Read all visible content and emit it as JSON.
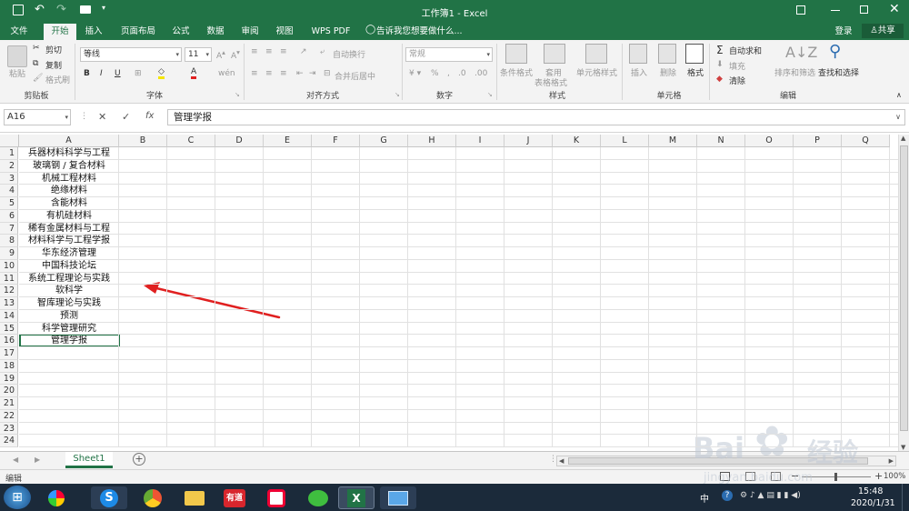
{
  "window": {
    "title": "工作簿1 - Excel"
  },
  "tabs": [
    "文件",
    "开始",
    "插入",
    "页面布局",
    "公式",
    "数据",
    "审阅",
    "视图",
    "WPS PDF"
  ],
  "tell_me": "告诉我您想要做什么...",
  "account": {
    "login": "登录",
    "share": "共享"
  },
  "ribbon": {
    "clipboard": {
      "label": "剪贴板",
      "paste": "粘贴",
      "cut": "剪切",
      "copy": "复制",
      "format_painter": "格式刷"
    },
    "font": {
      "label": "字体",
      "name": "等线",
      "size": "11"
    },
    "alignment": {
      "label": "对齐方式",
      "wrap": "自动换行",
      "merge": "合并后居中"
    },
    "number": {
      "label": "数字",
      "format": "常规"
    },
    "styles": {
      "label": "样式",
      "cond": "条件格式",
      "table1": "套用",
      "table2": "表格格式",
      "cell_style": "单元格样式"
    },
    "cells": {
      "label": "单元格",
      "insert": "插入",
      "delete": "删除",
      "format": "格式"
    },
    "editing": {
      "label": "编辑",
      "autosum": "自动求和",
      "fill": "填充",
      "clear": "清除",
      "sort": "排序和筛选",
      "find": "查找和选择"
    }
  },
  "formula_bar": {
    "name_box": "A16",
    "fx": "fx",
    "value": "管理学报"
  },
  "columns": [
    "A",
    "B",
    "C",
    "D",
    "E",
    "F",
    "G",
    "H",
    "I",
    "J",
    "K",
    "L",
    "M",
    "N",
    "O",
    "P",
    "Q"
  ],
  "rows": [
    "1",
    "2",
    "3",
    "4",
    "5",
    "6",
    "7",
    "8",
    "9",
    "10",
    "11",
    "12",
    "13",
    "14",
    "15",
    "16",
    "17",
    "18",
    "19",
    "20",
    "21",
    "22",
    "23",
    "24"
  ],
  "cells_a": [
    "兵器材料科学与工程",
    "玻璃钢 / 复合材料",
    "机械工程材料",
    "绝缘材料",
    "含能材料",
    "有机硅材料",
    "稀有金属材料与工程",
    "材料科学与工程学报",
    "华东经济管理",
    "中国科技论坛",
    "系统工程理论与实践",
    "软科学",
    "智库理论与实践",
    "预测",
    "科学管理研究",
    "管理学报"
  ],
  "sheet": {
    "name": "Sheet1"
  },
  "status": {
    "mode": "编辑",
    "zoom": "100%"
  },
  "watermark": {
    "brand": "Bai",
    "cn": "经验",
    "url": "jingyan.baidu.com"
  },
  "taskbar": {
    "time": "15:48",
    "date": "2020/1/31",
    "ime": "中"
  },
  "colors": {
    "excel_green": "#217346",
    "annotation_red": "#e02020"
  }
}
